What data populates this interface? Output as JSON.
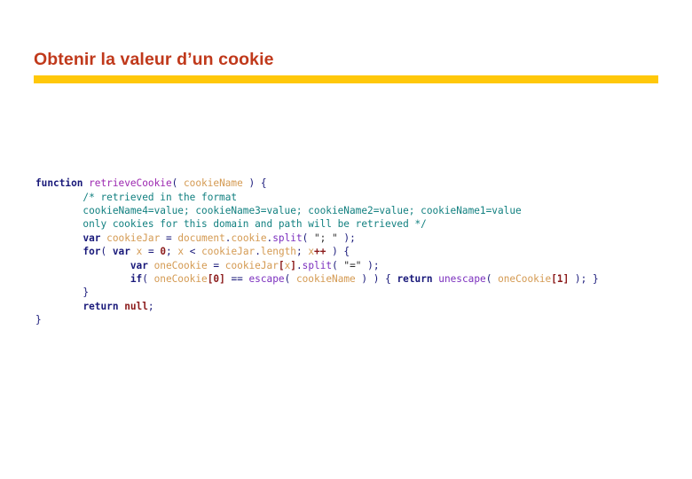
{
  "slide": {
    "title": "Obtenir la valeur d’un cookie",
    "accent_color": "#ffc80a",
    "title_color": "#c0391b",
    "background_color": "#ffffff"
  },
  "code": {
    "language": "javascript",
    "lines": [
      {
        "id": "line-1",
        "tokens": [
          {
            "t": "function",
            "c": "kw"
          },
          {
            "t": " ",
            "c": "plain"
          },
          {
            "t": "retrieveCookie",
            "c": "fnname"
          },
          {
            "t": "( ",
            "c": "punct"
          },
          {
            "t": "cookieName",
            "c": "ident"
          },
          {
            "t": " ) {",
            "c": "punct"
          }
        ]
      },
      {
        "id": "line-2",
        "tokens": [
          {
            "t": "        /* retrieved in the format",
            "c": "comment"
          }
        ]
      },
      {
        "id": "line-3",
        "tokens": [
          {
            "t": "        cookieName4=value; cookieName3=value; cookieName2=value; cookieName1=value",
            "c": "comment"
          }
        ]
      },
      {
        "id": "line-4",
        "tokens": [
          {
            "t": "        only cookies for this domain and path will be retrieved */",
            "c": "comment"
          }
        ]
      },
      {
        "id": "line-5",
        "tokens": [
          {
            "t": "        ",
            "c": "plain"
          },
          {
            "t": "var",
            "c": "kw"
          },
          {
            "t": " ",
            "c": "plain"
          },
          {
            "t": "cookieJar",
            "c": "ident"
          },
          {
            "t": " = ",
            "c": "punct"
          },
          {
            "t": "document",
            "c": "ident"
          },
          {
            "t": ".",
            "c": "punct"
          },
          {
            "t": "cookie",
            "c": "ident"
          },
          {
            "t": ".",
            "c": "punct"
          },
          {
            "t": "split",
            "c": "method"
          },
          {
            "t": "( ",
            "c": "punct"
          },
          {
            "t": "\"; \"",
            "c": "str"
          },
          {
            "t": " );",
            "c": "punct"
          }
        ]
      },
      {
        "id": "line-6",
        "tokens": [
          {
            "t": "        ",
            "c": "plain"
          },
          {
            "t": "for",
            "c": "kw"
          },
          {
            "t": "( ",
            "c": "punct"
          },
          {
            "t": "var",
            "c": "kw"
          },
          {
            "t": " ",
            "c": "plain"
          },
          {
            "t": "x",
            "c": "ident"
          },
          {
            "t": " = ",
            "c": "punct"
          },
          {
            "t": "0",
            "c": "num"
          },
          {
            "t": "; ",
            "c": "punct"
          },
          {
            "t": "x",
            "c": "ident"
          },
          {
            "t": " < ",
            "c": "punct"
          },
          {
            "t": "cookieJar",
            "c": "ident"
          },
          {
            "t": ".",
            "c": "punct"
          },
          {
            "t": "length",
            "c": "ident"
          },
          {
            "t": "; ",
            "c": "punct"
          },
          {
            "t": "x",
            "c": "ident"
          },
          {
            "t": "++",
            "c": "num"
          },
          {
            "t": " ) {",
            "c": "punct"
          }
        ]
      },
      {
        "id": "line-7",
        "tokens": [
          {
            "t": "                ",
            "c": "plain"
          },
          {
            "t": "var",
            "c": "kw"
          },
          {
            "t": " ",
            "c": "plain"
          },
          {
            "t": "oneCookie",
            "c": "ident"
          },
          {
            "t": " = ",
            "c": "punct"
          },
          {
            "t": "cookieJar",
            "c": "ident"
          },
          {
            "t": "[",
            "c": "num"
          },
          {
            "t": "x",
            "c": "ident"
          },
          {
            "t": "]",
            "c": "num"
          },
          {
            "t": ".",
            "c": "punct"
          },
          {
            "t": "split",
            "c": "method"
          },
          {
            "t": "( ",
            "c": "punct"
          },
          {
            "t": "\"=\"",
            "c": "str"
          },
          {
            "t": " );",
            "c": "punct"
          }
        ]
      },
      {
        "id": "line-8",
        "tokens": [
          {
            "t": "                ",
            "c": "plain"
          },
          {
            "t": "if",
            "c": "kw"
          },
          {
            "t": "( ",
            "c": "punct"
          },
          {
            "t": "oneCookie",
            "c": "ident"
          },
          {
            "t": "[",
            "c": "num"
          },
          {
            "t": "0",
            "c": "num"
          },
          {
            "t": "]",
            "c": "num"
          },
          {
            "t": " == ",
            "c": "punct"
          },
          {
            "t": "escape",
            "c": "builtin"
          },
          {
            "t": "( ",
            "c": "punct"
          },
          {
            "t": "cookieName",
            "c": "ident"
          },
          {
            "t": " ) ) { ",
            "c": "punct"
          },
          {
            "t": "return",
            "c": "kw"
          },
          {
            "t": " ",
            "c": "plain"
          },
          {
            "t": "unescape",
            "c": "builtin"
          },
          {
            "t": "( ",
            "c": "punct"
          },
          {
            "t": "oneCookie",
            "c": "ident"
          },
          {
            "t": "[",
            "c": "num"
          },
          {
            "t": "1",
            "c": "num"
          },
          {
            "t": "]",
            "c": "num"
          },
          {
            "t": " ); }",
            "c": "punct"
          }
        ]
      },
      {
        "id": "line-9",
        "tokens": [
          {
            "t": "        }",
            "c": "punct"
          }
        ]
      },
      {
        "id": "line-10",
        "tokens": [
          {
            "t": "        ",
            "c": "plain"
          },
          {
            "t": "return",
            "c": "kw"
          },
          {
            "t": " ",
            "c": "plain"
          },
          {
            "t": "null",
            "c": "nullv"
          },
          {
            "t": ";",
            "c": "punct"
          }
        ]
      },
      {
        "id": "line-11",
        "tokens": [
          {
            "t": "}",
            "c": "punct"
          }
        ]
      }
    ]
  }
}
